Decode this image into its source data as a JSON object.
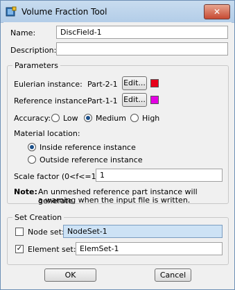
{
  "window": {
    "title": "Volume Fraction Tool",
    "close_glyph": "✕"
  },
  "form": {
    "name_label": "Name:",
    "name_value": "DiscField-1",
    "description_label": "Description:",
    "description_value": ""
  },
  "parameters": {
    "title": "Parameters",
    "eulerian_label": "Eulerian instance:",
    "eulerian_value": "Part-2-1",
    "eulerian_edit": "Edit...",
    "eulerian_color": "#e8001a",
    "reference_label": "Reference instance:",
    "reference_value": "Part-1-1",
    "reference_edit": "Edit...",
    "reference_color": "#e400e4",
    "accuracy_label": "Accuracy:",
    "accuracy_options": [
      "Low",
      "Medium",
      "High"
    ],
    "accuracy_selected": "Medium",
    "material_location_label": "Material location:",
    "material_options": [
      "Inside reference instance",
      "Outside reference instance"
    ],
    "material_selected": "Inside reference instance",
    "scale_label": "Scale factor (0<f<=1):",
    "scale_value": "1",
    "note_bold": "Note:",
    "note_line1": "An unmeshed reference part instance will generate",
    "note_line2": "a warning when the input file is written."
  },
  "set_creation": {
    "title": "Set Creation",
    "node_set_label": "Node set:",
    "node_set_checked": false,
    "node_set_value": "NodeSet-1",
    "element_set_label": "Element set:",
    "element_set_checked": true,
    "element_set_value": "ElemSet-1"
  },
  "buttons": {
    "ok": "OK",
    "cancel": "Cancel"
  },
  "icons": {
    "title": "volume-fraction-tool-icon",
    "check": "✓"
  }
}
